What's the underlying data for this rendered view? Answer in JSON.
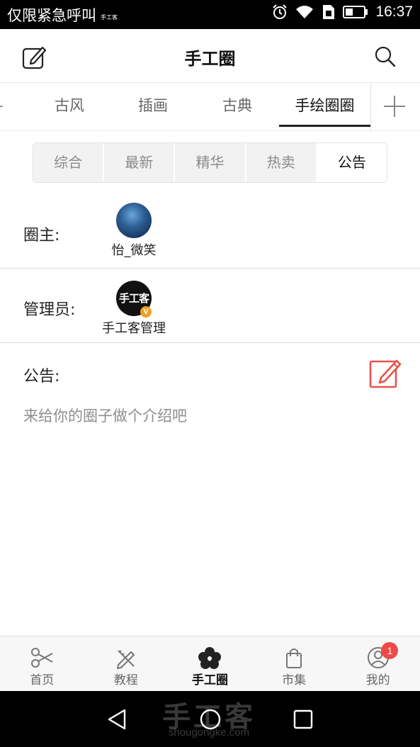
{
  "status_bar": {
    "carrier": "仅限紧急呼叫",
    "carrier_small": "手工客",
    "time": "16:37",
    "icons": [
      "alarm-icon",
      "wifi-icon",
      "sim-icon",
      "battery-icon"
    ]
  },
  "header": {
    "title": "手工圈",
    "left_icon": "edit-icon",
    "right_icon": "search-icon"
  },
  "category_tabs": {
    "items": [
      "古风",
      "插画",
      "古典",
      "手绘圈圈"
    ],
    "active": "手绘圈圈",
    "add_icon": "plus-icon"
  },
  "segments": {
    "items": [
      "综合",
      "最新",
      "精华",
      "热卖",
      "公告"
    ],
    "active": "公告"
  },
  "owner": {
    "label": "圈主:",
    "name": "怡_微笑",
    "avatar_icon": "night-sky-avatar"
  },
  "admin": {
    "label": "管理员:",
    "name": "手工客管理",
    "avatar_text": "手工客",
    "badge": "V"
  },
  "announcement": {
    "label": "公告:",
    "placeholder": "来给你的圈子做个介绍吧",
    "edit_icon": "edit-square-icon",
    "accent": "#e8534a"
  },
  "bottom_nav": {
    "items": [
      {
        "label": "首页",
        "icon": "scissors-icon"
      },
      {
        "label": "教程",
        "icon": "pencil-ruler-icon"
      },
      {
        "label": "手工圈",
        "icon": "flower-icon"
      },
      {
        "label": "市集",
        "icon": "shopping-bag-icon"
      },
      {
        "label": "我的",
        "icon": "user-icon",
        "badge": "1"
      }
    ],
    "active": "手工圈",
    "badge_color": "#f04848"
  },
  "watermark": {
    "text": "手工客",
    "sub": "shougongke.com"
  }
}
